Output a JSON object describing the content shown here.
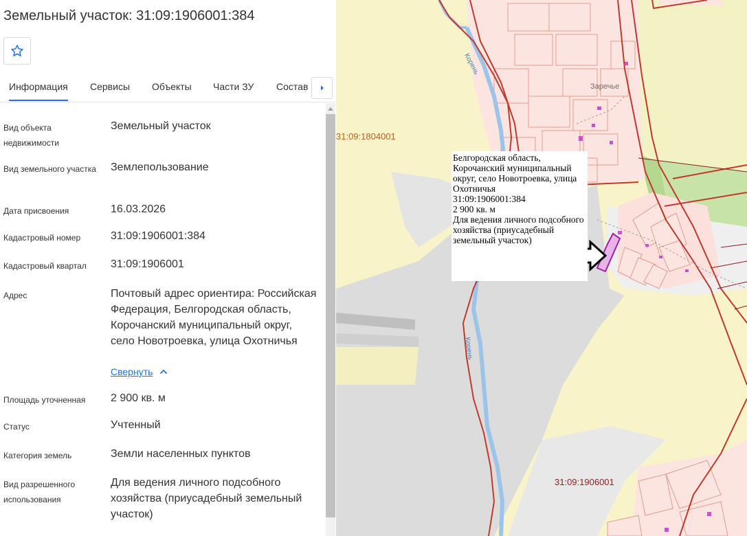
{
  "header": {
    "title": "Земельный участок: 31:09:1906001:384"
  },
  "tabs": [
    {
      "label": "Информация"
    },
    {
      "label": "Сервисы"
    },
    {
      "label": "Объекты"
    },
    {
      "label": "Части ЗУ"
    },
    {
      "label": "Состав"
    }
  ],
  "info": {
    "object_type": {
      "label": "Вид объекта недвижимости",
      "value": "Земельный участок"
    },
    "parcel_type": {
      "label": "Вид земельного участка",
      "value": "Землепользование"
    },
    "date": {
      "label": "Дата присвоения",
      "value": "16.03.2026"
    },
    "cadastral_number": {
      "label": "Кадастровый номер",
      "value": "31:09:1906001:384"
    },
    "cadastral_quarter": {
      "label": "Кадастровый квартал",
      "value": "31:09:1906001"
    },
    "address": {
      "label": "Адрес",
      "value": "Почтовый адрес ориентира: Российская Федерация, Белгородская область, Корочанский муниципальный округ, село Новотроевка, улица Охотничья"
    },
    "collapse_label": "Свернуть",
    "area": {
      "label": "Площадь уточненная",
      "value": "2 900 кв. м"
    },
    "status": {
      "label": "Статус",
      "value": "Учтенный"
    },
    "land_category": {
      "label": "Категория земель",
      "value": "Земли населенных пунктов"
    },
    "permitted_use": {
      "label": "Вид разрешенного использования",
      "value": "Для ведения личного подсобного хозяйства (приусадебный земельный участок)"
    }
  },
  "map": {
    "labels": {
      "quarter_1": "31:09:1804001",
      "quarter_2": "31:09:1906001",
      "village": "Заречье",
      "river_1": "Корень",
      "river_2": "Корень"
    },
    "popup": {
      "address": "Белгородская область, Корочанский муниципальный округ, село Новотроевка, улица Охотничья",
      "cadastral_number": "31:09:1906001:384",
      "area": "2 900 кв. м",
      "use": "Для ведения личного подсобного хозяйства (приусадебный земельный участок)"
    }
  },
  "colors": {
    "accent": "#1a73e8",
    "map_background": "#f8f3c8",
    "boundary": "#c0392b",
    "parcel_fill": "#fbe0dc",
    "selected_parcel": "#e8b4e8",
    "river": "#9cc3e8"
  },
  "icons": [
    "star-icon",
    "chevron-right-icon",
    "chevron-up-icon",
    "arrow-pointer-icon"
  ]
}
